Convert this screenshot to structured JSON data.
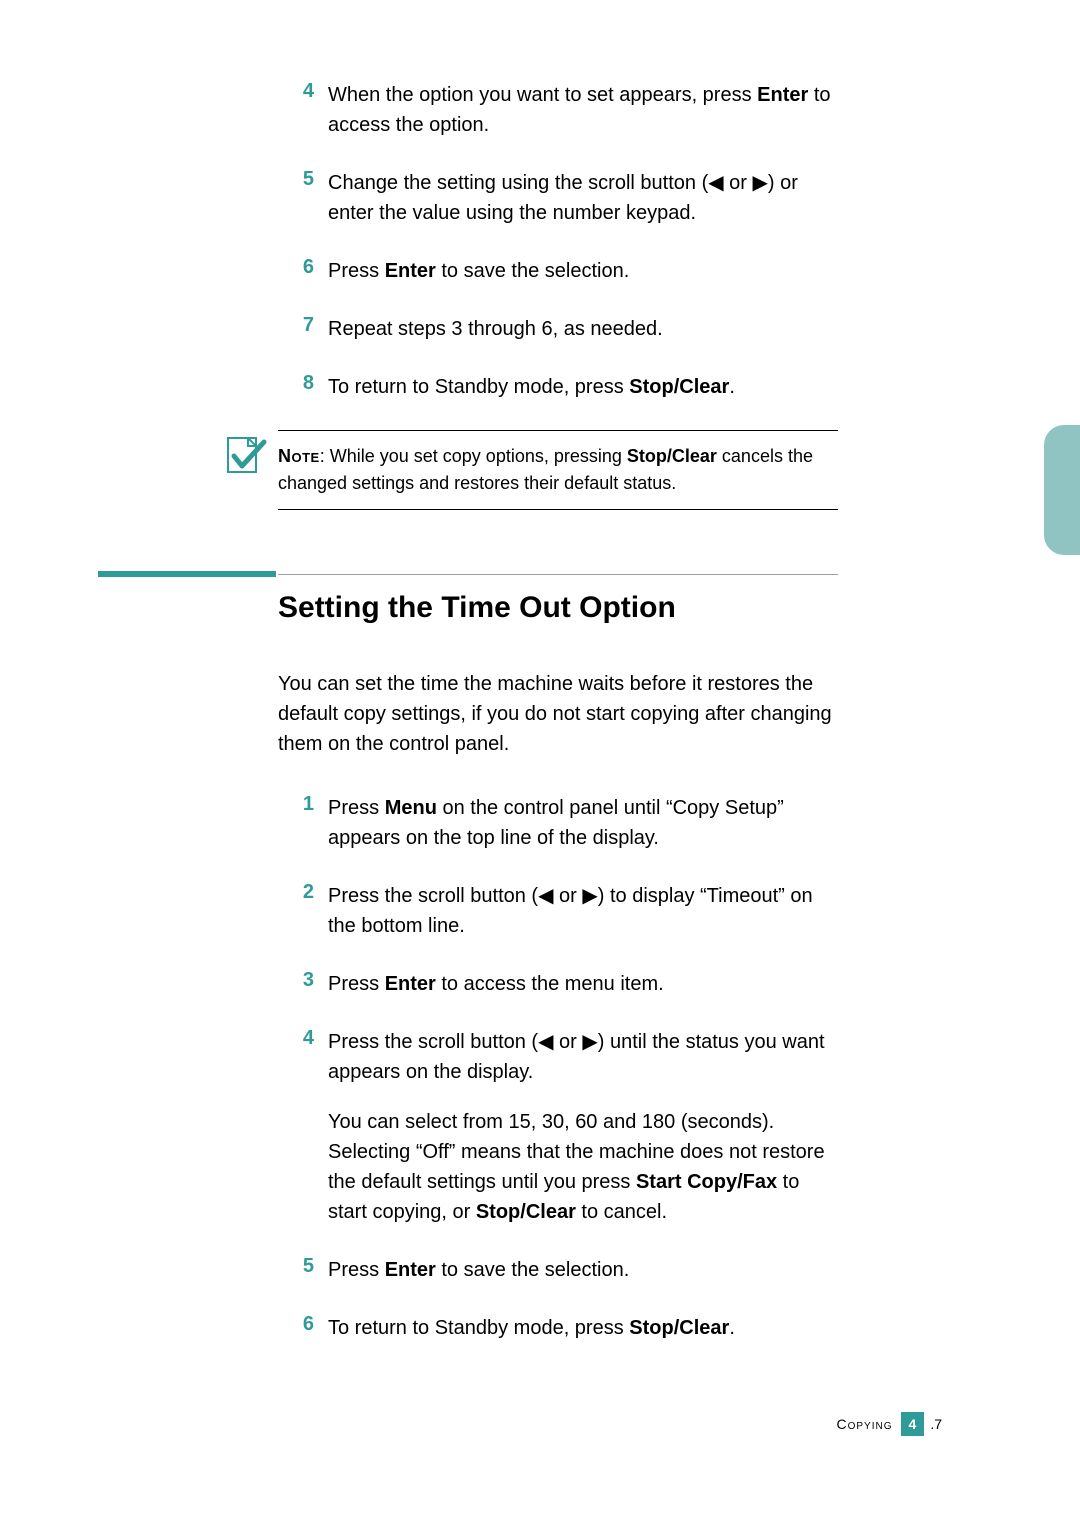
{
  "steps1": [
    {
      "num": "4",
      "html": "When the option you want to set appears, press <b>Enter</b> to access the option."
    },
    {
      "num": "5",
      "html": "Change the setting using the scroll button (◀ or ▶) or enter the value using the number keypad."
    },
    {
      "num": "6",
      "html": "Press <b>Enter</b> to save the selection."
    },
    {
      "num": "7",
      "html": "Repeat steps 3 through 6, as needed."
    },
    {
      "num": "8",
      "html": "To return to Standby mode, press <b>Stop/Clear</b>."
    }
  ],
  "note": {
    "label": "Note",
    "body": ": While you set copy options, pressing <b>Stop/Clear</b> cancels the changed settings and restores their default status."
  },
  "heading": "Setting the Time Out Option",
  "intro": "You can set the time the machine waits before it restores the default copy settings, if you do not start copying after changing them on the control panel.",
  "steps2": [
    {
      "num": "1",
      "html": "Press <b>Menu</b> on the control panel until “Copy Setup” appears on the top line of the display."
    },
    {
      "num": "2",
      "html": "Press the scroll button (◀ or ▶) to display “Timeout” on the bottom line."
    },
    {
      "num": "3",
      "html": "Press <b>Enter</b> to access the menu item."
    },
    {
      "num": "4",
      "html": "Press the scroll button (◀ or ▶) until the status you want appears on the display.",
      "extra": "You can select from 15, 30, 60 and 180 (seconds). Selecting “Off” means that the machine does not restore the default settings until you press <b>Start Copy/Fax</b> to start copying, or <b>Stop/Clear</b> to cancel."
    },
    {
      "num": "5",
      "html": "Press <b>Enter</b> to save the selection."
    },
    {
      "num": "6",
      "html": "To return to Standby mode, press <b>Stop/Clear</b>."
    }
  ],
  "footer": {
    "section": "Copying",
    "chapter": "4",
    "page": ".7"
  },
  "colors": {
    "accent": "#2f9b98",
    "tab": "#8fc4c2"
  }
}
